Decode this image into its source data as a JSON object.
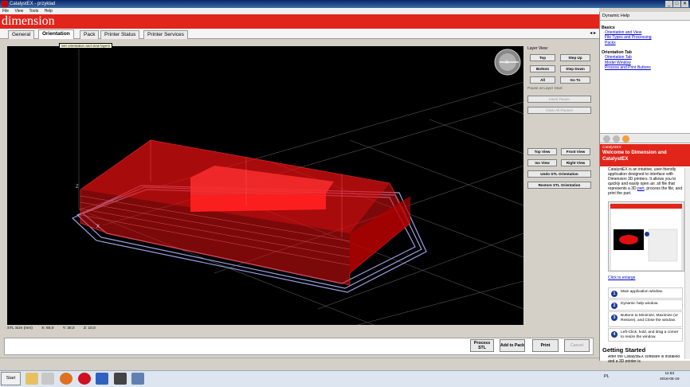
{
  "window": {
    "title": "CatalystEX - przyklad"
  },
  "menu": [
    "File",
    "View",
    "Tools",
    "Help"
  ],
  "brand": "dimension",
  "tabs": [
    "General",
    "Orientation",
    "Pack",
    "Printer Status",
    "Printer Services"
  ],
  "tab_arrows": "◂ ▸",
  "tooltip": "Set orientation and view layers",
  "layer_view": {
    "label": "Layer View:",
    "top": "Top",
    "step_up": "Step Up",
    "bottom": "Bottom",
    "step_down": "Step Down",
    "all": "All",
    "go_to": "Go To",
    "pause_label": "Pause at Layer Start",
    "insert_pause": "Insert Pause",
    "clear_all_pauses": "Clear All Pauses"
  },
  "views": {
    "top_view": "Top View",
    "front_view": "Front View",
    "iso_view": "Iso View",
    "right_view": "Right View",
    "undo": "Undo STL Orientation",
    "restore": "Restore STL Orientation"
  },
  "stl_size": {
    "label": "STL Size (mm)",
    "x": "X: 60,0",
    "y": "Y: 30,0",
    "z": "Z: 10,0"
  },
  "axis_labels": {
    "z": "Z",
    "x": "X",
    "view_cube": "-X"
  },
  "actions": {
    "process": "Process STL",
    "add_to_pack": "Add to Pack",
    "print": "Print",
    "cancel": "Cancel"
  },
  "help": {
    "header": "Dynamic Help",
    "basics_title": "Basics",
    "basics_links": [
      "Orientation and View",
      "File Types and Processing",
      "Packs"
    ],
    "orientation_title": "Orientation Tab",
    "orientation_links": [
      "Orientation Tab",
      "Model Window",
      "Process and Print Buttons"
    ],
    "banner_small": "CatalystEX",
    "banner_title": "Welcome to Dimension and CatalystEX",
    "intro_pre": "CatalystEX is an intuitive, user-friendly application designed to interface with Dimension 3D printers. It allows you to quickly and easily open an .stl file that represents a 3D ",
    "intro_link": "part",
    "intro_post": ", process the file, and print the part.",
    "click_to_enlarge": "Click to enlarge",
    "steps": [
      {
        "n": "1",
        "text": "Main application window."
      },
      {
        "n": "2",
        "text": "Dynamic help window."
      },
      {
        "n": "3",
        "text": "Buttons to Minimize, Maximize (or Restore), and Close the window."
      },
      {
        "n": "4",
        "text": "Left-Click, hold, and drag a corner to resize the window."
      }
    ],
    "getting_started_title": "Getting Started",
    "getting_started_text": "After the CatalystEX software is installed and a 3D printer is"
  },
  "taskbar": {
    "start": "Start",
    "lang": "PL",
    "time": "11:53",
    "date": "2018-06-19"
  },
  "colors": {
    "brand_red": "#e1251b",
    "model_red": "#e01010",
    "support": "#9aa0e0"
  }
}
